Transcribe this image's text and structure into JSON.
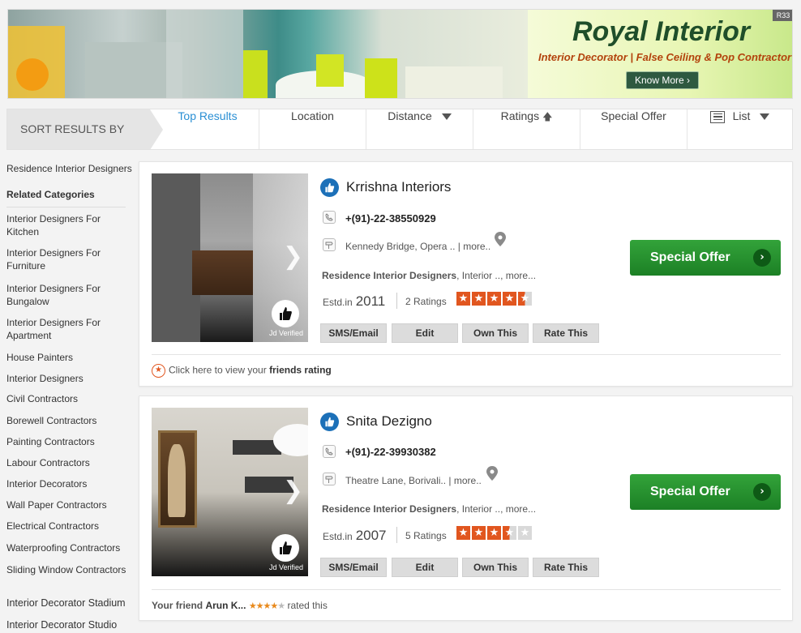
{
  "banner": {
    "title": "Royal Interior",
    "subtitle": "Interior Decorator | False Ceiling & Pop Contractor",
    "cta": "Know More ›",
    "badge": "R33"
  },
  "sortbar": {
    "label": "SORT RESULTS BY",
    "items": [
      "Top Results",
      "Location",
      "Distance",
      "Ratings",
      "Special Offer",
      "List"
    ]
  },
  "sidebar": {
    "current": "Residence Interior Designers",
    "heading": "Related Categories",
    "items": [
      "Interior Designers For Kitchen",
      "Interior Designers For Furniture",
      "Interior Designers For Bungalow",
      "Interior Designers For Apartment",
      "House Painters",
      "Interior Designers",
      "Civil Contractors",
      "Borewell Contractors",
      "Painting Contractors",
      "Labour Contractors",
      "Interior Decorators",
      "Wall Paper Contractors",
      "Electrical Contractors",
      "Waterproofing Contractors",
      "Sliding Window Contractors",
      "Interior Decorator Stadium",
      "Interior Decorator Studio"
    ]
  },
  "listings": [
    {
      "name": "Krrishna Interiors",
      "phone": "+(91)-22-38550929",
      "address": "Kennedy Bridge, Opera .. | more..",
      "category_bold": "Residence Interior Designers",
      "category_rest": ", Interior ..,  more...",
      "estd_label": "Estd.in",
      "estd_year": "2011",
      "ratings": "2 Ratings",
      "stars": 4.5,
      "verified": "Jd Verified",
      "buttons": [
        "SMS/Email",
        "Edit",
        "Own This",
        "Rate This"
      ],
      "offer": "Special Offer",
      "footer_text": "Click here to view your",
      "footer_bold": "friends rating"
    },
    {
      "name": "Snita Dezigno",
      "phone": "+(91)-22-39930382",
      "address": "Theatre Lane, Borivali.. | more..",
      "category_bold": "Residence Interior Designers",
      "category_rest": ", Interior ..,  more...",
      "estd_label": "Estd.in",
      "estd_year": "2007",
      "ratings": "5 Ratings",
      "stars": 3.5,
      "verified": "Jd Verified",
      "buttons": [
        "SMS/Email",
        "Edit",
        "Own This",
        "Rate This"
      ],
      "offer": "Special Offer",
      "footer_prefix": "Your friend",
      "footer_name": "Arun K...",
      "footer_stars": 4,
      "footer_suffix": "rated this"
    }
  ],
  "colors": {
    "accent_blue": "#2a8fd4",
    "offer_green": "#1c8025",
    "star_orange": "#e1561f"
  }
}
